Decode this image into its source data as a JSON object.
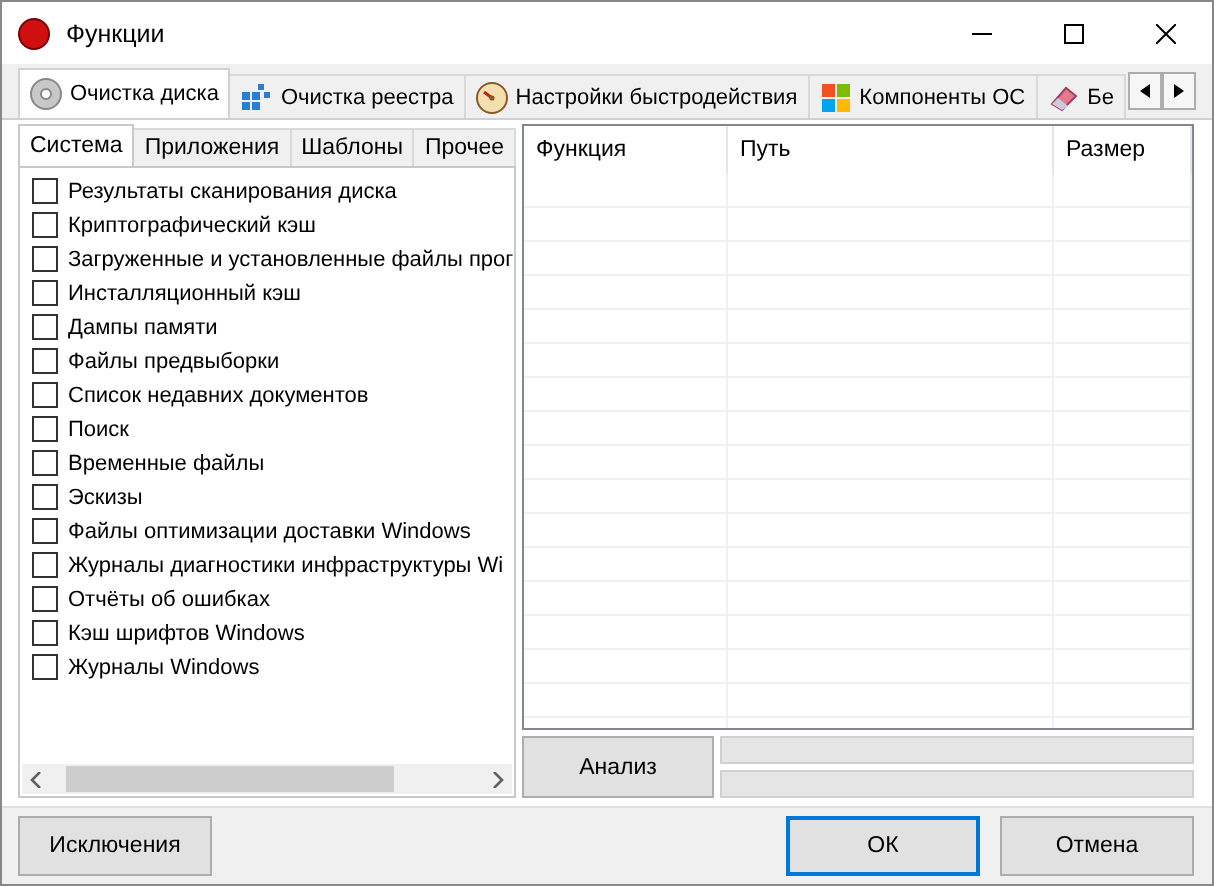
{
  "window": {
    "title": "Функции"
  },
  "tabs": [
    {
      "label": "Очистка диска",
      "kind": "disc",
      "selected": true
    },
    {
      "label": "Очистка реестра",
      "kind": "registry",
      "selected": false
    },
    {
      "label": "Настройки быстродействия",
      "kind": "gauge",
      "selected": false
    },
    {
      "label": "Компоненты ОС",
      "kind": "os",
      "selected": false
    },
    {
      "label": "Бе",
      "kind": "eraser",
      "selected": false
    }
  ],
  "subtabs": [
    {
      "label": "Система",
      "selected": true
    },
    {
      "label": "Приложения",
      "selected": false
    },
    {
      "label": "Шаблоны",
      "selected": false
    },
    {
      "label": "Прочее",
      "selected": false
    }
  ],
  "items": [
    {
      "label": "Результаты сканирования диска",
      "checked": false
    },
    {
      "label": "Криптографический кэш",
      "checked": false
    },
    {
      "label": "Загруженные и установленные файлы прог",
      "checked": false
    },
    {
      "label": "Инсталляционный кэш",
      "checked": false
    },
    {
      "label": "Дампы памяти",
      "checked": false
    },
    {
      "label": "Файлы предвыборки",
      "checked": false
    },
    {
      "label": "Список недавних документов",
      "checked": false
    },
    {
      "label": "Поиск",
      "checked": false
    },
    {
      "label": "Временные файлы",
      "checked": false
    },
    {
      "label": "Эскизы",
      "checked": false
    },
    {
      "label": "Файлы оптимизации доставки Windows",
      "checked": false
    },
    {
      "label": "Журналы диагностики инфраструктуры Wi",
      "checked": false
    },
    {
      "label": "Отчёты об ошибках",
      "checked": false
    },
    {
      "label": "Кэш шрифтов Windows",
      "checked": false
    },
    {
      "label": "Журналы Windows",
      "checked": false
    }
  ],
  "table": {
    "columns": [
      "Функция",
      "Путь",
      "Размер"
    ]
  },
  "analyze_button": "Анализ",
  "progress": [
    {
      "level": 0
    },
    {
      "level": 0
    }
  ],
  "buttons": {
    "exclusions": "Исключения",
    "ok": "ОК",
    "cancel": "Отмена"
  }
}
